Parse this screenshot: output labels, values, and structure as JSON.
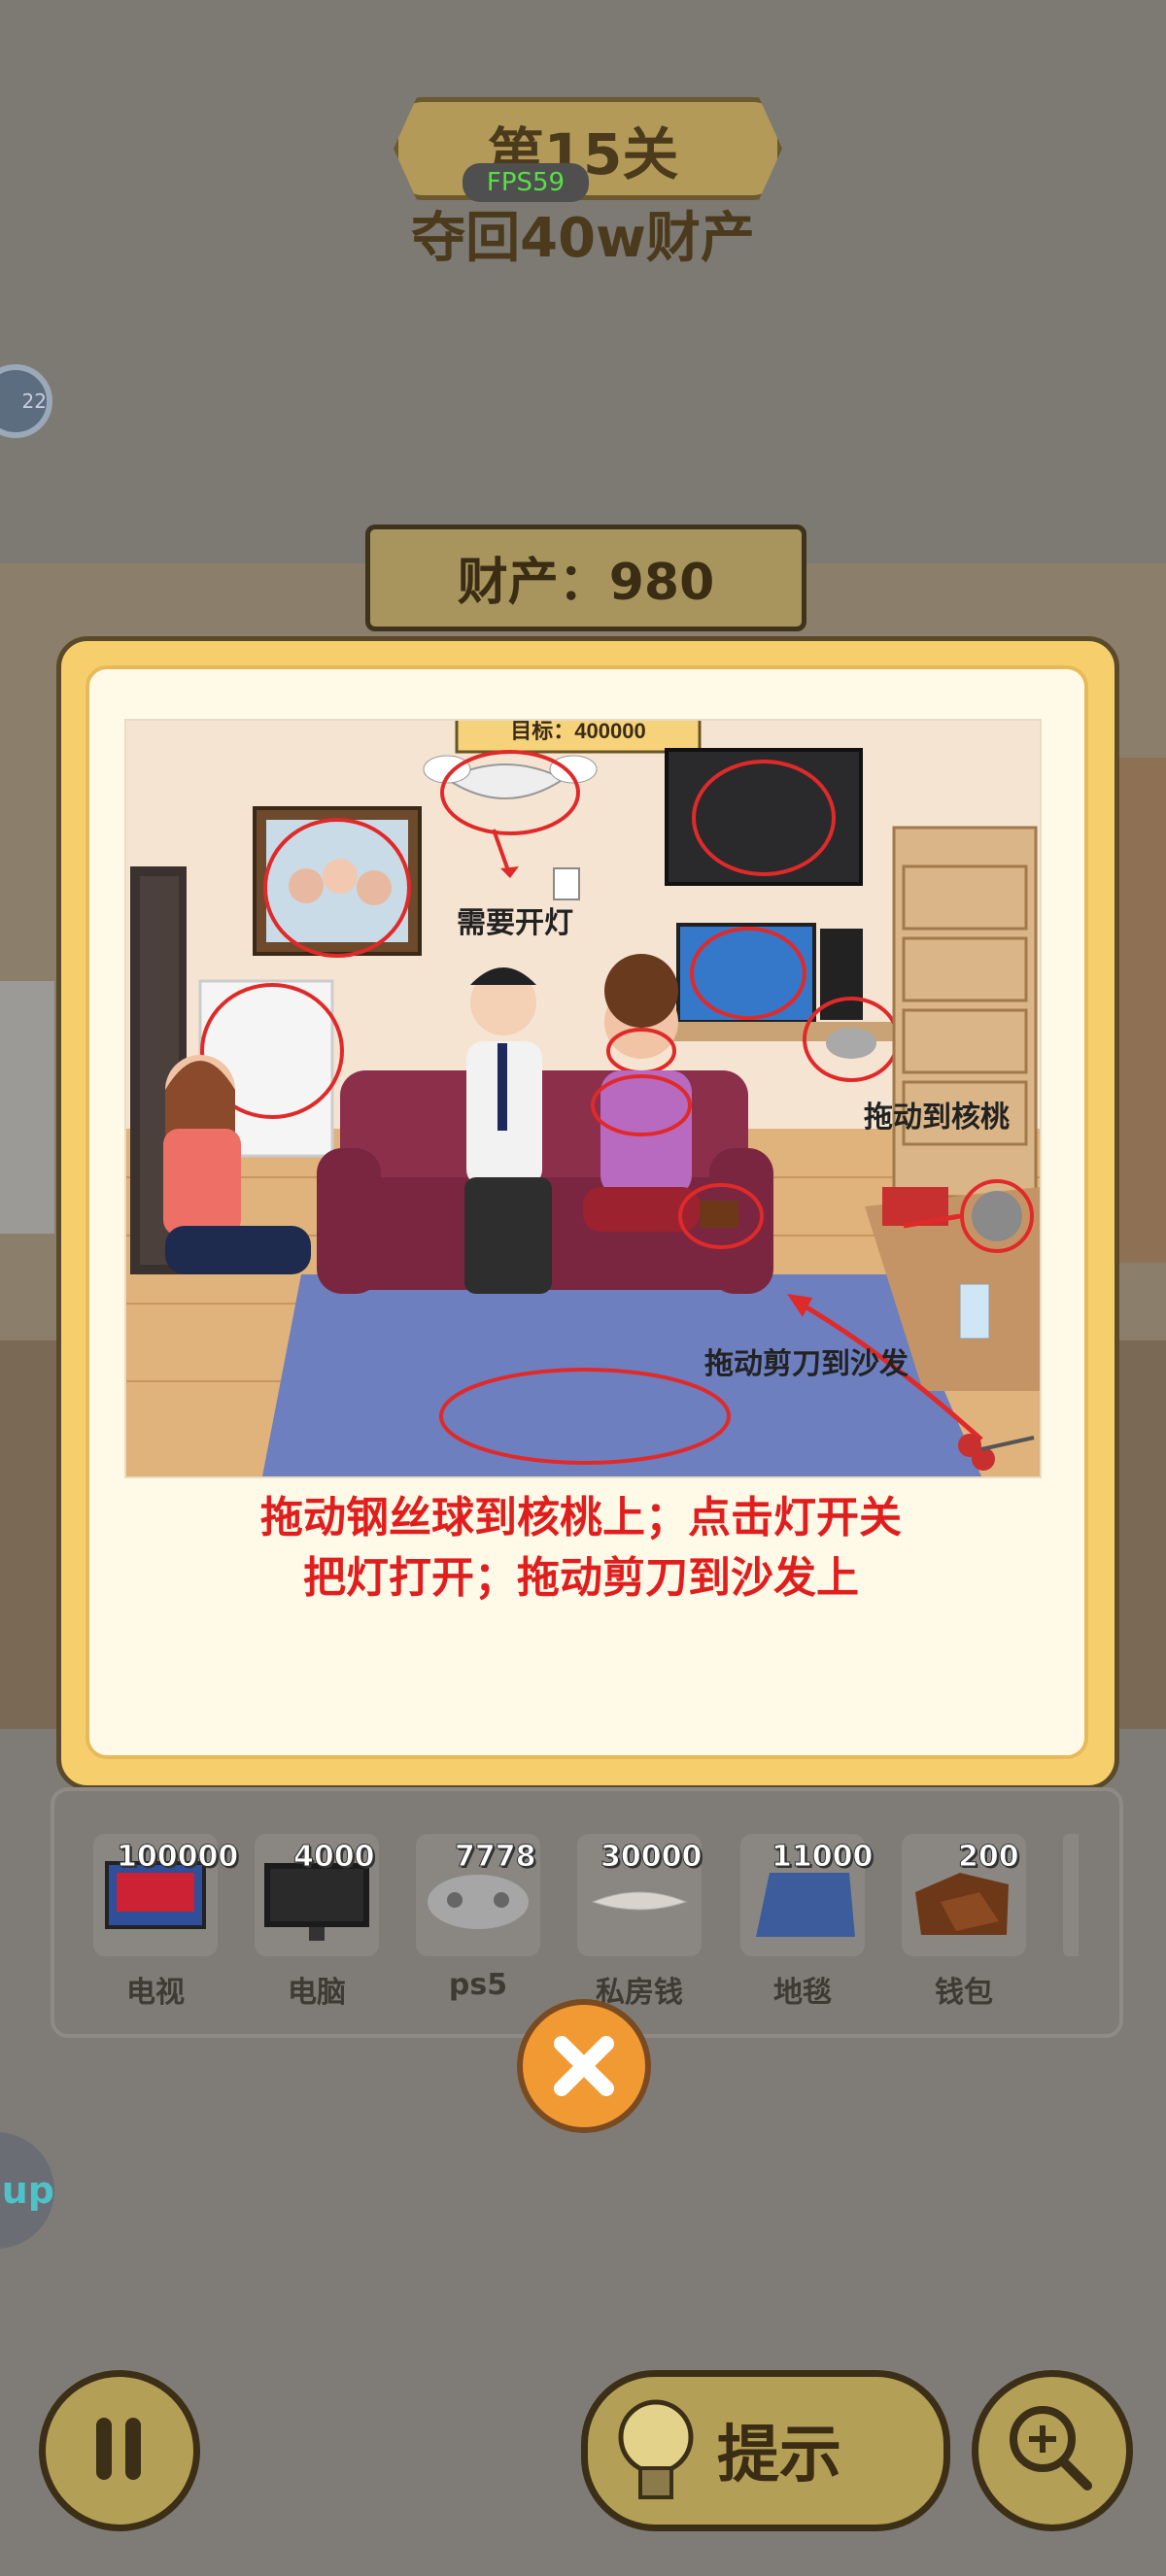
{
  "level": {
    "title": "第15关",
    "subtitle": "夺回40w财产",
    "fps": "FPS59",
    "side_badge": "22"
  },
  "money": {
    "label": "财产：980"
  },
  "modal": {
    "scene_labels": {
      "need_light": "需要开灯",
      "drag_walnut": "拖动到核桃",
      "drag_scissors": "拖动剪刀到沙发",
      "top_banner": "目标：400000"
    },
    "instruction_line1": "拖动钢丝球到核桃上；点击灯开关",
    "instruction_line2": "把灯打开；拖动剪刀到沙发上"
  },
  "items": [
    {
      "value": "100000",
      "name": "电视"
    },
    {
      "value": "4000",
      "name": "电脑"
    },
    {
      "value": "7778",
      "name": "ps5"
    },
    {
      "value": "30000",
      "name": "私房钱"
    },
    {
      "value": "11000",
      "name": "地毯"
    },
    {
      "value": "200",
      "name": "钱包"
    }
  ],
  "buttons": {
    "hint": "提示",
    "up": "up"
  },
  "colors": {
    "accent": "#f19a33",
    "instruction": "#e11e1e",
    "panel": "#f6cf6c"
  }
}
